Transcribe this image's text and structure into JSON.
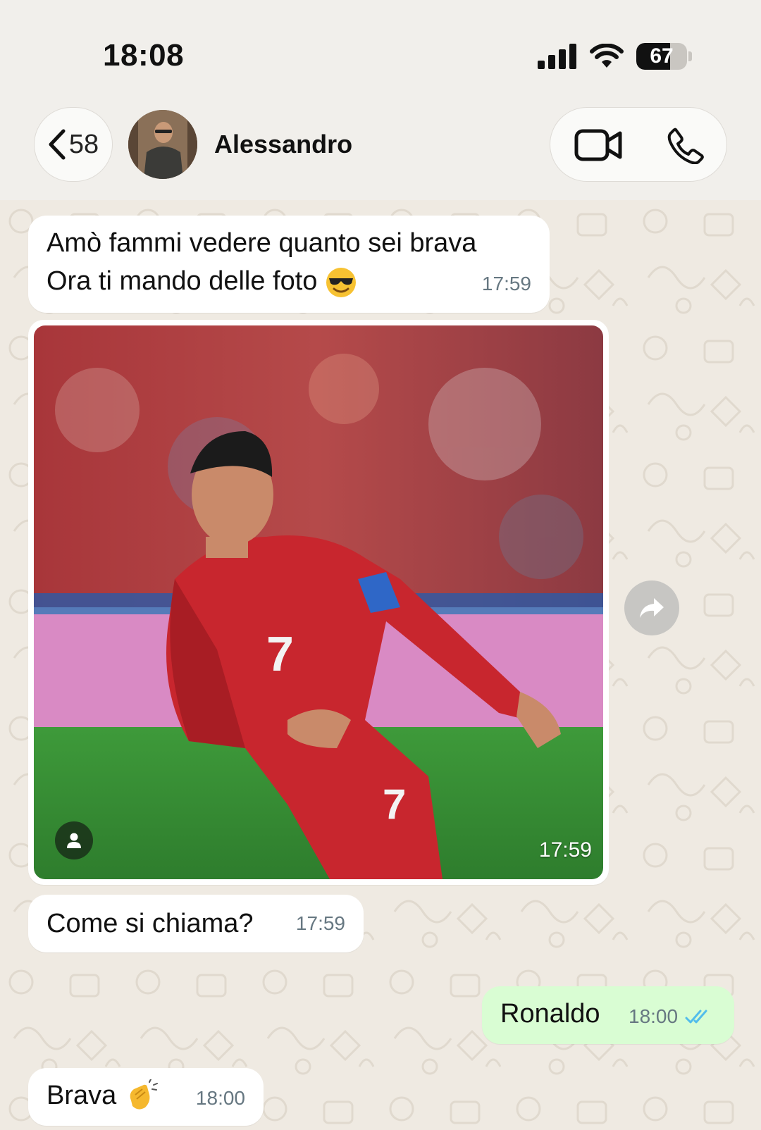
{
  "status_bar": {
    "time": "18:08",
    "battery_percent": "67",
    "battery_level": 0.67
  },
  "header": {
    "back_count": "58",
    "contact_name": "Alessandro",
    "icons": [
      "chevron-left-icon",
      "video-call-icon",
      "phone-call-icon"
    ]
  },
  "messages": [
    {
      "direction": "in",
      "lines": [
        "Amò fammi vedere quanto  sei brava",
        "Ora ti mando delle foto"
      ],
      "emoji": "smiling-face-with-sunglasses",
      "time": "17:59"
    },
    {
      "direction": "in",
      "type": "photo",
      "time": "17:59"
    },
    {
      "direction": "in",
      "text": "Come si chiama?",
      "time": "17:59"
    },
    {
      "direction": "out",
      "text": "Ronaldo",
      "time": "18:00",
      "read": true
    },
    {
      "direction": "in",
      "text": "Brava",
      "emoji": "clapping-hands",
      "time": "18:00"
    }
  ],
  "colors": {
    "incoming_bubble": "#ffffff",
    "outgoing_bubble": "#d9fdd3",
    "read_ticks": "#53bdeb",
    "wallpaper": "#efeae2"
  }
}
